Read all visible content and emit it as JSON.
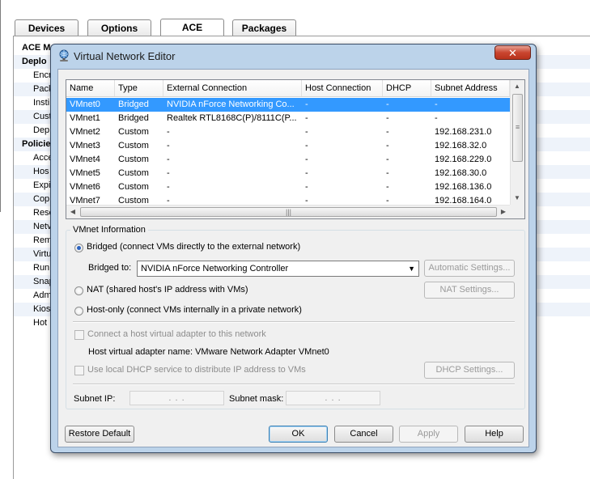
{
  "background": {
    "tabs": [
      "Devices",
      "Options",
      "ACE",
      "Packages"
    ],
    "sidebar_items": [
      "ACE M",
      "Deplo",
      "Encr",
      "Pack",
      "Insti",
      "Cust",
      "Dep",
      "Policie",
      "Acce",
      "Hos",
      "Expi",
      "Cop",
      "Rese",
      "Netv",
      "Rem",
      "Virtu",
      "Run",
      "Snap",
      "Adm",
      "Kios",
      "Hot"
    ]
  },
  "dialog": {
    "title": "Virtual Network Editor",
    "close_symbol": "✕",
    "table": {
      "columns": [
        "Name",
        "Type",
        "External Connection",
        "Host Connection",
        "DHCP",
        "Subnet Address"
      ],
      "rows": [
        {
          "name": "VMnet0",
          "type": "Bridged",
          "external": "NVIDIA nForce Networking Co...",
          "host": "-",
          "dhcp": "-",
          "subnet": "-"
        },
        {
          "name": "VMnet1",
          "type": "Bridged",
          "external": "Realtek RTL8168C(P)/8111C(P...",
          "host": "-",
          "dhcp": "-",
          "subnet": "-"
        },
        {
          "name": "VMnet2",
          "type": "Custom",
          "external": "-",
          "host": "-",
          "dhcp": "-",
          "subnet": "192.168.231.0"
        },
        {
          "name": "VMnet3",
          "type": "Custom",
          "external": "-",
          "host": "-",
          "dhcp": "-",
          "subnet": "192.168.32.0"
        },
        {
          "name": "VMnet4",
          "type": "Custom",
          "external": "-",
          "host": "-",
          "dhcp": "-",
          "subnet": "192.168.229.0"
        },
        {
          "name": "VMnet5",
          "type": "Custom",
          "external": "-",
          "host": "-",
          "dhcp": "-",
          "subnet": "192.168.30.0"
        },
        {
          "name": "VMnet6",
          "type": "Custom",
          "external": "-",
          "host": "-",
          "dhcp": "-",
          "subnet": "192.168.136.0"
        },
        {
          "name": "VMnet7",
          "type": "Custom",
          "external": "-",
          "host": "-",
          "dhcp": "-",
          "subnet": "192.168.164.0"
        }
      ],
      "selected_index": 0
    },
    "vmnet_info": {
      "legend": "VMnet Information",
      "bridged_label": "Bridged (connect VMs directly to the external network)",
      "bridged_to_label": "Bridged to:",
      "bridged_to_value": "NVIDIA nForce Networking Controller",
      "automatic_settings": "Automatic Settings...",
      "nat_label": "NAT (shared host's IP address with VMs)",
      "nat_settings": "NAT Settings...",
      "hostonly_label": "Host-only (connect VMs internally in a private network)",
      "connect_adapter_label": "Connect a host virtual adapter to this network",
      "adapter_name_text": "Host virtual adapter name: VMware Network Adapter VMnet0",
      "dhcp_label": "Use local DHCP service to distribute IP address to VMs",
      "dhcp_settings": "DHCP Settings...",
      "subnet_ip_label": "Subnet IP:",
      "subnet_ip_value": ".   .   .",
      "subnet_mask_label": "Subnet mask:",
      "subnet_mask_value": ".   .   ."
    },
    "buttons": {
      "restore_default": "Restore Default",
      "ok": "OK",
      "cancel": "Cancel",
      "apply": "Apply",
      "help": "Help"
    }
  }
}
